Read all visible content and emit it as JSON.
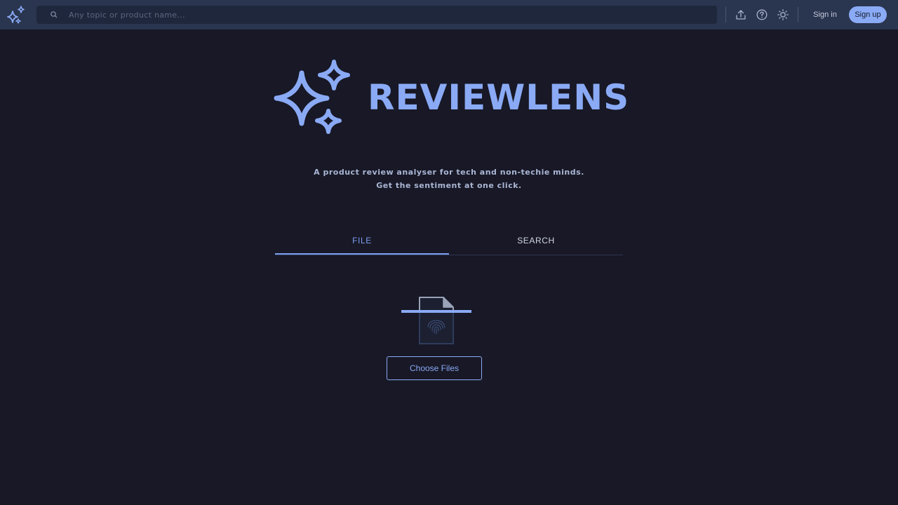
{
  "header": {
    "search": {
      "placeholder": "Any topic or product name..."
    },
    "signin_label": "Sign in",
    "signup_label": "Sign up",
    "icons": [
      "sparkles-logo-icon",
      "search-icon",
      "upload-icon",
      "help-icon",
      "sun-icon"
    ]
  },
  "hero": {
    "brand": "REVIEWLENS",
    "tagline": "A product review analyser for tech and non-techie minds. Get the sentiment at one click."
  },
  "tabs": [
    {
      "label": "FILE",
      "active": true
    },
    {
      "label": "SEARCH",
      "active": false
    }
  ],
  "upload": {
    "button_label": "Choose Files",
    "icon": "fingerprint-document-icon"
  },
  "colors": {
    "background": "#181826",
    "topbar": "#2a3550",
    "accent": "#8aaaf5",
    "tab_active": "#7b9df0"
  }
}
